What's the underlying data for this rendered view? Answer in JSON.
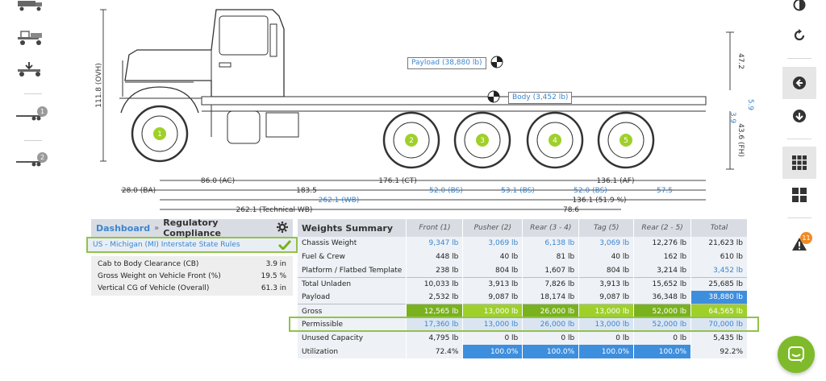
{
  "left_rail": {
    "items": [
      {
        "icon": "truck-icon"
      },
      {
        "icon": "truck-chassis-icon"
      },
      {
        "icon": "truck-download-icon"
      },
      {
        "icon": "trailer-icon",
        "badge": "1"
      },
      {
        "icon": "trailer-icon",
        "badge": "2"
      }
    ]
  },
  "right_rail": {
    "items": [
      {
        "icon": "half-circle-icon"
      },
      {
        "icon": "rotate-icon"
      },
      {
        "icon": "arrow-left-circle-icon"
      },
      {
        "icon": "arrow-down-circle-icon"
      },
      {
        "icon": "grid-9-icon"
      },
      {
        "icon": "grid-4-icon"
      },
      {
        "icon": "warning-icon",
        "badge": "11"
      }
    ]
  },
  "drawing": {
    "ovh_label": "111.8 (OVH)",
    "dim_47": "47.2",
    "dim_5_9": "5.9",
    "dim_3_9": "3.9",
    "fh_label": "43.6 (FH)",
    "payload_callout": "Payload (38,880 lb)",
    "body_callout": "Body (3,452 lb)",
    "axles": [
      "1",
      "2",
      "3",
      "4",
      "5"
    ],
    "dims": {
      "ac": "86.0 (AC)",
      "ct": "176.1 (CT)",
      "af": "136.1 (AF)",
      "ba": "28.0 (BA)",
      "d183": "183.5",
      "bs1": "52.0 (BS)",
      "bs2": "53.1 (BS)",
      "bs3": "52.0 (BS)",
      "d575": "57.5",
      "wb": "262.1 (WB)",
      "pct": "136.1 (51.9 %)",
      "tech": "262.1 (Technical WB)",
      "d786": "78.6"
    }
  },
  "left_panel": {
    "breadcrumb_link": "Dashboard",
    "breadcrumb_sep": "»",
    "breadcrumb_current": "Regulatory Compliance",
    "rule_text": "US - Michigan (MI) Interstate State Rules",
    "rows": [
      {
        "k": "Cab to Body Clearance (CB)",
        "v": "3.9 in"
      },
      {
        "k": "Gross Weight on Vehicle Front (%)",
        "v": "19.5 %"
      },
      {
        "k": "Vertical CG of Vehicle (Overall)",
        "v": "61.3 in"
      }
    ]
  },
  "weights": {
    "title": "Weights Summary",
    "headers": [
      "Front (1)",
      "Pusher (2)",
      "Rear (3 - 4)",
      "Tag (5)",
      "Rear (2 - 5)",
      "Total"
    ],
    "rows": [
      {
        "label": "Chassis Weight",
        "cells": [
          "9,347 lb",
          "3,069 lb",
          "6,138 lb",
          "3,069 lb",
          "12,276 lb",
          "21,623 lb"
        ]
      },
      {
        "label": "Fuel & Crew",
        "cells": [
          "448 lb",
          "40 lb",
          "81 lb",
          "40 lb",
          "162 lb",
          "610 lb"
        ]
      },
      {
        "label": "Platform / Flatbed Template",
        "cells": [
          "238 lb",
          "804 lb",
          "1,607 lb",
          "804 lb",
          "3,214 lb",
          "3,452 lb"
        ]
      },
      {
        "label": "Total Unladen",
        "cells": [
          "10,033 lb",
          "3,913 lb",
          "7,826 lb",
          "3,913 lb",
          "15,652 lb",
          "25,685 lb"
        ]
      },
      {
        "label": "Payload",
        "cells": [
          "2,532 lb",
          "9,087 lb",
          "18,174 lb",
          "9,087 lb",
          "36,348 lb",
          "38,880 lb"
        ]
      },
      {
        "label": "Gross",
        "cells": [
          "12,565 lb",
          "13,000 lb",
          "26,000 lb",
          "13,000 lb",
          "52,000 lb",
          "64,565 lb"
        ]
      },
      {
        "label": "Permissible",
        "cells": [
          "17,360 lb",
          "13,000 lb",
          "26,000 lb",
          "13,000 lb",
          "52,000 lb",
          "70,000 lb"
        ]
      },
      {
        "label": "Unused Capacity",
        "cells": [
          "4,795 lb",
          "0 lb",
          "0 lb",
          "0 lb",
          "0 lb",
          "5,435 lb"
        ]
      },
      {
        "label": "Utilization",
        "cells": [
          "72.4%",
          "100.0%",
          "100.0%",
          "100.0%",
          "100.0%",
          "92.2%"
        ]
      }
    ]
  },
  "colors": {
    "accent_blue": "#3a86d0",
    "cell_blue": "#3e8ede",
    "green_dark": "#79b21c",
    "green_light": "#9fd02a",
    "highlight_outline": "#92c24a",
    "chat_green": "#7fba2a",
    "warning_orange": "#f08a24"
  }
}
